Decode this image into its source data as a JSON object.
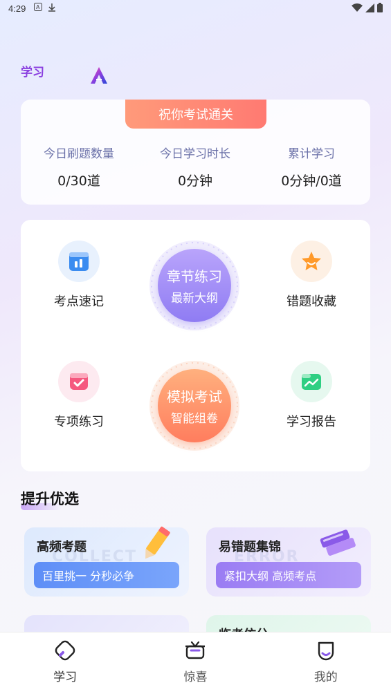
{
  "status": {
    "time": "4:29"
  },
  "header": {
    "title": "学习"
  },
  "stats": {
    "banner": "祝你考试通关",
    "items": [
      {
        "label": "今日刷题数量",
        "value": "0/30道"
      },
      {
        "label": "今日学习时长",
        "value": "0分钟"
      },
      {
        "label": "累计学习",
        "value": "0分钟/0道"
      }
    ]
  },
  "menu": {
    "items": [
      {
        "label": "考点速记",
        "icon": "notebook-icon"
      },
      {
        "label": "错题收藏",
        "icon": "star-icon"
      },
      {
        "label": "专项练习",
        "icon": "checkmark-folder-icon"
      },
      {
        "label": "学习报告",
        "icon": "chart-icon"
      }
    ],
    "chapter": {
      "line1": "章节练习",
      "line2": "最新大纲"
    },
    "mock": {
      "line1": "模拟考试",
      "line2": "智能组卷"
    }
  },
  "section": {
    "title": "提升优选"
  },
  "promos": [
    {
      "title": "高频考题",
      "tag": "百里挑一 分秒必争",
      "watermark": "COLLECT"
    },
    {
      "title": "易错题集锦",
      "tag": "紧扣大纲 高频考点",
      "watermark": "ERROR"
    },
    {
      "title": "",
      "tag": ""
    },
    {
      "title": "临考仿分",
      "tag": ""
    }
  ],
  "nav": {
    "items": [
      {
        "label": "学习",
        "icon": "pencil-icon"
      },
      {
        "label": "惊喜",
        "icon": "gift-box-icon"
      },
      {
        "label": "我的",
        "icon": "profile-icon"
      }
    ]
  }
}
